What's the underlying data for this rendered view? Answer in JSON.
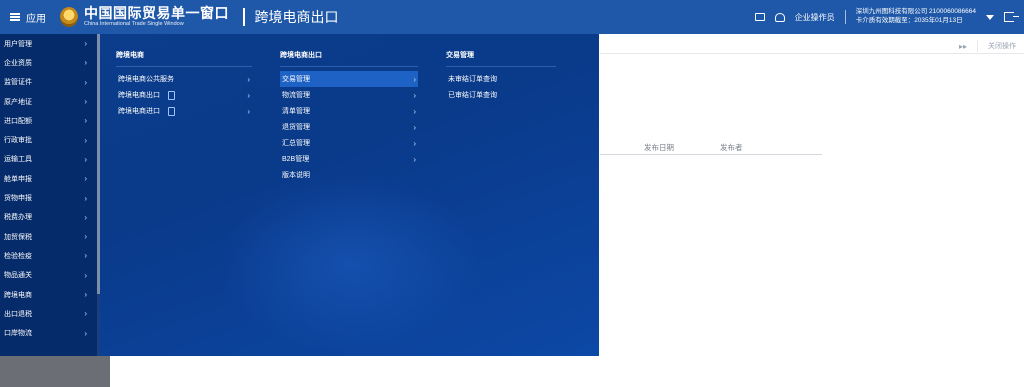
{
  "header": {
    "app_label": "应用",
    "title_cn": "中国国际贸易单一窗口",
    "title_en": "China International Trade Single Window",
    "system_title": "跨境电商出口",
    "role": "企业操作员",
    "company": "深圳九州图科技有限公司 2100060086664",
    "card_expiry": "卡介质有效期截至：2035年01月13日"
  },
  "sidebar": {
    "items": [
      {
        "label": "用户管理"
      },
      {
        "label": "企业资质"
      },
      {
        "label": "监管证件"
      },
      {
        "label": "原产地证"
      },
      {
        "label": "进口配额"
      },
      {
        "label": "行政审批"
      },
      {
        "label": "运输工具"
      },
      {
        "label": "舱单申报"
      },
      {
        "label": "货物申报"
      },
      {
        "label": "税费办理"
      },
      {
        "label": "加贸保税"
      },
      {
        "label": "检验检疫"
      },
      {
        "label": "物品通关"
      },
      {
        "label": "跨境电商"
      },
      {
        "label": "出口退税"
      },
      {
        "label": "口岸物流"
      }
    ]
  },
  "mega_menu": {
    "col1": {
      "title": "跨境电商",
      "items": [
        {
          "label": "跨境电商公共服务"
        },
        {
          "label": "跨境电商出口"
        },
        {
          "label": "跨境电商进口"
        }
      ]
    },
    "col2": {
      "title": "跨境电商出口",
      "items": [
        {
          "label": "交易管理"
        },
        {
          "label": "物流管理"
        },
        {
          "label": "清单管理"
        },
        {
          "label": "退货管理"
        },
        {
          "label": "汇总管理"
        },
        {
          "label": "B2B管理"
        },
        {
          "label": "版本说明"
        }
      ]
    },
    "col3": {
      "title": "交易管理",
      "items": [
        {
          "label": "未审结订单查询"
        },
        {
          "label": "已审结订单查询"
        }
      ]
    }
  },
  "main": {
    "close_ops": "关闭操作",
    "columns": [
      {
        "label": "发布日期"
      },
      {
        "label": "发布者"
      }
    ]
  },
  "colors": {
    "header_bg": "#1f58a8",
    "sidebar_bg": "#062b6a",
    "menu_bg": "#0b3d8c",
    "active_item": "#1e62c6"
  }
}
